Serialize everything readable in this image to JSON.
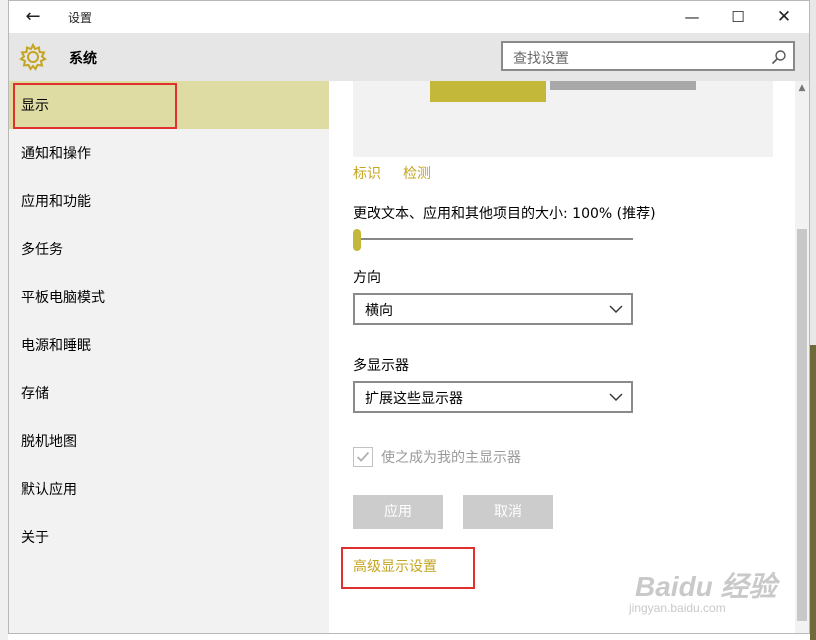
{
  "window": {
    "title": "设置"
  },
  "header": {
    "title": "系统",
    "search_placeholder": "查找设置"
  },
  "sidebar": {
    "items": [
      {
        "label": "显示",
        "active": true
      },
      {
        "label": "通知和操作"
      },
      {
        "label": "应用和功能"
      },
      {
        "label": "多任务"
      },
      {
        "label": "平板电脑模式"
      },
      {
        "label": "电源和睡眠"
      },
      {
        "label": "存储"
      },
      {
        "label": "脱机地图"
      },
      {
        "label": "默认应用"
      },
      {
        "label": "关于"
      }
    ]
  },
  "main": {
    "identify_label": "标识",
    "detect_label": "检测",
    "scale_label": "更改文本、应用和其他项目的大小: 100% (推荐)",
    "scale_value": 0,
    "orientation_label": "方向",
    "orientation_value": "横向",
    "multi_display_label": "多显示器",
    "multi_display_value": "扩展这些显示器",
    "primary_checkbox_label": "使之成为我的主显示器",
    "apply_label": "应用",
    "cancel_label": "取消",
    "advanced_link": "高级显示设置"
  },
  "watermark": {
    "line1": "Baidu 经验",
    "line2": "jingyan.baidu.com"
  },
  "colors": {
    "accent": "#c4b83a",
    "link": "#c4a521",
    "highlight_box": "#e0312e",
    "active_nav": "#dedba3"
  }
}
